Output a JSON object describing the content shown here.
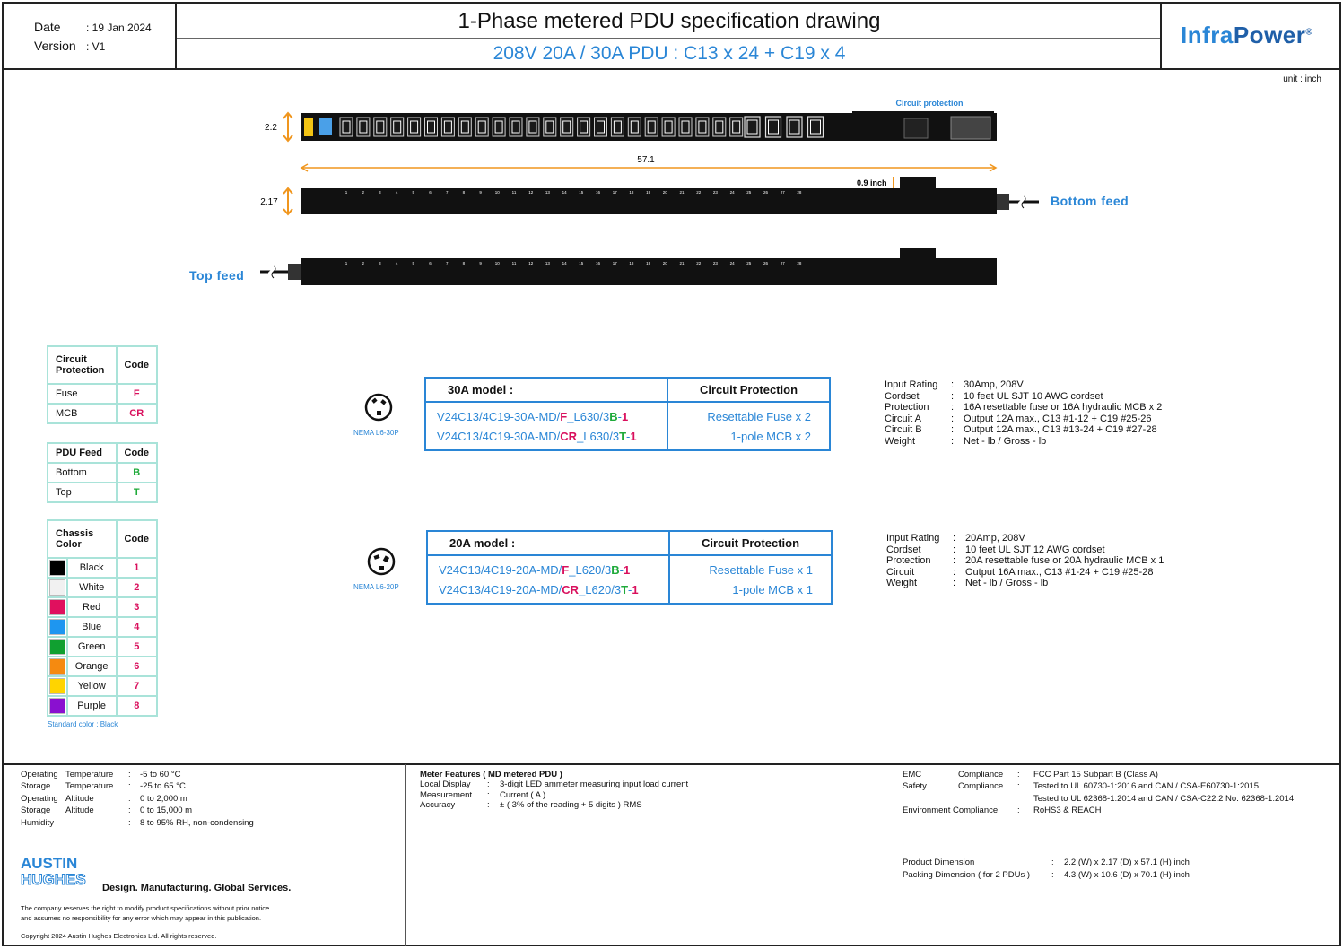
{
  "header": {
    "date_label": "Date",
    "date_value": ": 19 Jan 2024",
    "version_label": "Version",
    "version_value": ": V1",
    "title": "1-Phase metered PDU specification drawing",
    "subtitle": "208V 20A / 30A PDU  :  C13 x 24  +  C19  x 4",
    "logo_infra": "Infra",
    "logo_power": "Power",
    "logo_reg": "®"
  },
  "drawing": {
    "unit_label": "unit : inch",
    "circuit_protection_label": "Circuit protection",
    "width_dim": "2.2",
    "depth_dim": "2.17",
    "length_dim": "57.1",
    "meter_dim": "0.9 inch",
    "bottom_feed": "Bottom feed",
    "top_feed": "Top feed",
    "outlet_numbers": [
      "1",
      "2",
      "3",
      "4",
      "5",
      "6",
      "7",
      "8",
      "9",
      "10",
      "11",
      "12",
      "13",
      "14",
      "15",
      "16",
      "17",
      "18",
      "19",
      "20",
      "21",
      "22",
      "23",
      "24",
      "25",
      "26",
      "27",
      "28"
    ]
  },
  "legend": {
    "circuit": {
      "header1": "Circuit Protection",
      "header2": "Code",
      "rows": [
        {
          "name": "Fuse",
          "code": "F"
        },
        {
          "name": "MCB",
          "code": "CR"
        }
      ]
    },
    "feed": {
      "header1": "PDU Feed",
      "header2": "Code",
      "rows": [
        {
          "name": "Bottom",
          "code": "B"
        },
        {
          "name": "Top",
          "code": "T"
        }
      ]
    },
    "color": {
      "header1": "Chassis Color",
      "header2": "Code",
      "rows": [
        {
          "name": "Black",
          "code": "1",
          "swatch": "#000000"
        },
        {
          "name": "White",
          "code": "2",
          "swatch": "#f1f1f1"
        },
        {
          "name": "Red",
          "code": "3",
          "swatch": "#e0105e"
        },
        {
          "name": "Blue",
          "code": "4",
          "swatch": "#1e96f0"
        },
        {
          "name": "Green",
          "code": "5",
          "swatch": "#10a030"
        },
        {
          "name": "Orange",
          "code": "6",
          "swatch": "#f58a10"
        },
        {
          "name": "Yellow",
          "code": "7",
          "swatch": "#ffd400"
        },
        {
          "name": "Purple",
          "code": "8",
          "swatch": "#8a10d0"
        }
      ],
      "note": "Standard color : Black"
    }
  },
  "models": {
    "m30": {
      "nema": "NEMA L6-30P",
      "header": "30A model :",
      "prot_header": "Circuit Protection",
      "rows": [
        {
          "pre": "V24C13/4C19-30A-MD/",
          "c1": "F",
          "mid": "_L630/3",
          "c2": "B",
          "dash": "-",
          "c3": "1",
          "prot": "Resettable Fuse x 2"
        },
        {
          "pre": "V24C13/4C19-30A-MD/",
          "c1": "CR",
          "mid": "_L630/3",
          "c2": "T",
          "dash": "-",
          "c3": "1",
          "prot": "1-pole MCB x 2"
        }
      ],
      "specs": [
        {
          "k": "Input Rating",
          "v": "30Amp, 208V"
        },
        {
          "k": "Cordset",
          "v": "10 feet UL SJT 10 AWG cordset"
        },
        {
          "k": "Protection",
          "v": "16A resettable fuse or 16A hydraulic MCB  x 2"
        },
        {
          "k": "Circuit A",
          "v": "Output 12A max., C13  #1-12  +  C19  #25-26"
        },
        {
          "k": "Circuit B",
          "v": "Output 12A max., C13  #13-24  +  C19  #27-28"
        },
        {
          "k": "Weight",
          "v": "Net - lb / Gross - lb"
        }
      ]
    },
    "m20": {
      "nema": "NEMA L6-20P",
      "header": "20A model :",
      "prot_header": "Circuit Protection",
      "rows": [
        {
          "pre": "V24C13/4C19-20A-MD/",
          "c1": "F",
          "mid": "_L620/3",
          "c2": "B",
          "dash": "-",
          "c3": "1",
          "prot": "Resettable Fuse x 1"
        },
        {
          "pre": "V24C13/4C19-20A-MD/",
          "c1": "CR",
          "mid": "_L620/3",
          "c2": "T",
          "dash": "-",
          "c3": "1",
          "prot": "1-pole MCB x 1"
        }
      ],
      "specs": [
        {
          "k": "Input Rating",
          "v": "20Amp, 208V"
        },
        {
          "k": "Cordset",
          "v": "10 feet UL SJT 12 AWG cordset"
        },
        {
          "k": "Protection",
          "v": "20A resettable fuse or 20A hydraulic MCB  x 1"
        },
        {
          "k": "Circuit",
          "v": "Output 16A max., C13  #1-24  +  C19  #25-28"
        },
        {
          "k": "Weight",
          "v": "Net - lb / Gross - lb"
        }
      ]
    }
  },
  "footer": {
    "env": [
      {
        "a": "Operating",
        "b": "Temperature",
        "v": "-5 to 60 °C"
      },
      {
        "a": "Storage",
        "b": "Temperature",
        "v": "-25 to 65 °C"
      },
      {
        "a": "Operating",
        "b": "Altitude",
        "v": "0 to 2,000 m"
      },
      {
        "a": "Storage",
        "b": "Altitude",
        "v": "0 to 15,000 m"
      },
      {
        "a": "Humidity",
        "b": "",
        "v": "8 to 95% RH, non-condensing"
      }
    ],
    "brand_top": "AUSTIN",
    "brand_bottom": "HUGHES",
    "tagline": "Design. Manufacturing. Global Services.",
    "disclaimer1": "The company reserves the right to modify product specifications without prior notice",
    "disclaimer2": "and assumes no responsibility for any error which may appear in this publication.",
    "copyright": "Copyright 2024 Austin Hughes Electronics Ltd. All rights reserved.",
    "meter_title": "Meter Features ( MD metered PDU )",
    "meter": [
      {
        "k": "Local Display",
        "v": "3-digit LED ammeter measuring input load current"
      },
      {
        "k": "Measurement",
        "v": "Current ( A )"
      },
      {
        "k": "Accuracy",
        "v": "± ( 3% of the reading + 5 digits ) RMS"
      }
    ],
    "compliance": [
      {
        "a": "EMC",
        "b": "Compliance",
        "v": "FCC Part 15 Subpart B (Class A)"
      },
      {
        "a": "Safety",
        "b": "Compliance",
        "v": "Tested to UL 60730-1:2016 and CAN / CSA-E60730-1:2015"
      },
      {
        "a": "",
        "b": "",
        "v": "Tested to UL 62368-1:2014 and CAN / CSA-C22.2 No. 62368-1:2014"
      }
    ],
    "env_compliance_label": "Environment Compliance",
    "env_compliance_value": "RoHS3 & REACH",
    "product_dim_label": "Product Dimension",
    "product_dim_value": "2.2 (W) x 2.17 (D) x 57.1 (H) inch",
    "packing_dim_label": "Packing Dimension ( for 2 PDUs )",
    "packing_dim_value": "4.3 (W) x 10.6 (D) x 70.1 (H) inch"
  }
}
